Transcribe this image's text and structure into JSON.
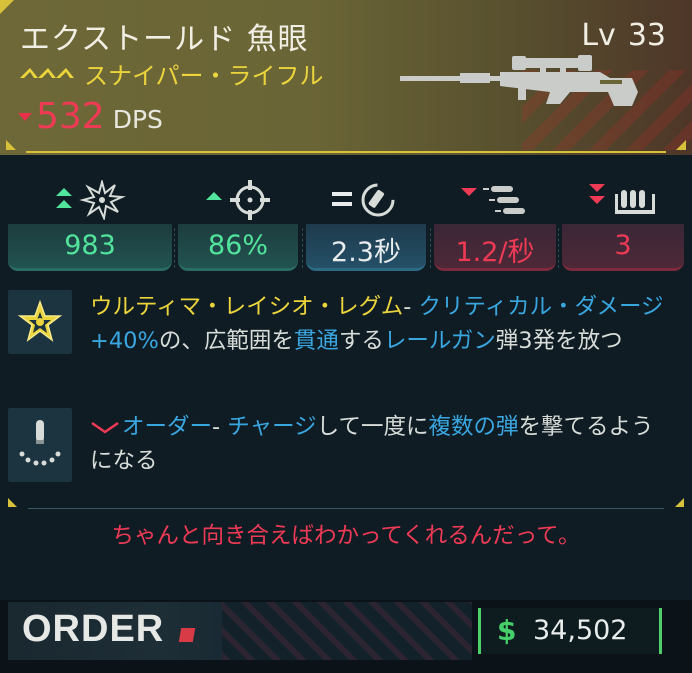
{
  "item": {
    "name": "エクストールド 魚眼",
    "level_label": "Lv",
    "level": "33",
    "type": "スナイパー・ライフル",
    "dps_value": "532",
    "dps_label": "DPS"
  },
  "stats": [
    {
      "name": "damage",
      "value": "983",
      "trend": "up",
      "color": "green"
    },
    {
      "name": "accuracy",
      "value": "86%",
      "trend": "up",
      "color": "green"
    },
    {
      "name": "reload",
      "value": "2.3秒",
      "trend": "equal",
      "color": "blue"
    },
    {
      "name": "fire-rate",
      "value": "1.2/秒",
      "trend": "down",
      "color": "red"
    },
    {
      "name": "magazine",
      "value": "3",
      "trend": "down",
      "color": "red"
    }
  ],
  "perks": [
    {
      "name": "ultima-ratio-regum",
      "segments": [
        {
          "text": "ウルティマ・レイシオ・レグム",
          "style": "y"
        },
        {
          "text": "- ",
          "style": "n"
        },
        {
          "text": "クリティカル・ダメージ+40%",
          "style": "b"
        },
        {
          "text": "の、広範囲を",
          "style": "n"
        },
        {
          "text": "貫通",
          "style": "b"
        },
        {
          "text": "する",
          "style": "n"
        },
        {
          "text": "レールガン",
          "style": "b"
        },
        {
          "text": "弾3発を放つ",
          "style": "n"
        }
      ]
    },
    {
      "name": "order",
      "segments": [
        {
          "text": "オーダー",
          "style": "b"
        },
        {
          "text": "- ",
          "style": "n"
        },
        {
          "text": "チャージ",
          "style": "b"
        },
        {
          "text": "して一度に",
          "style": "n"
        },
        {
          "text": "複数の弾",
          "style": "b"
        },
        {
          "text": "を撃てるようになる",
          "style": "n"
        }
      ]
    }
  ],
  "flavor_text": "ちゃんと向き合えばわかってくれるんだって。",
  "footer": {
    "brand": "ORDER",
    "price": "34,502",
    "currency_icon": "dollar-icon"
  },
  "colors": {
    "accent_yellow": "#ecd43c",
    "positive_green": "#52e39c",
    "negative_red": "#ee3a55",
    "keyword_blue": "#3aa6e0"
  }
}
